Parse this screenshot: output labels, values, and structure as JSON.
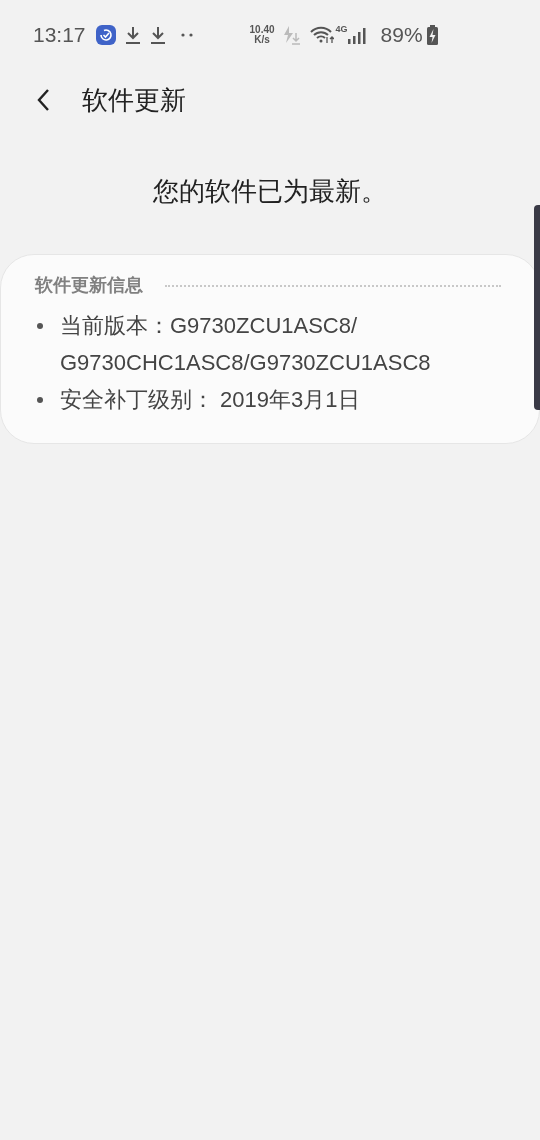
{
  "status_bar": {
    "time": "13:17",
    "net_speed": "10.40",
    "net_speed_unit": "K/s",
    "network_type": "4G",
    "battery": "89%"
  },
  "header": {
    "title": "软件更新"
  },
  "message": "您的软件已为最新。",
  "info_card": {
    "title": "软件更新信息",
    "items": [
      "当前版本：G9730ZCU1ASC8/G9730CHC1ASC8/G9730ZCU1ASC8",
      "安全补丁级别： 2019年3月1日"
    ]
  }
}
